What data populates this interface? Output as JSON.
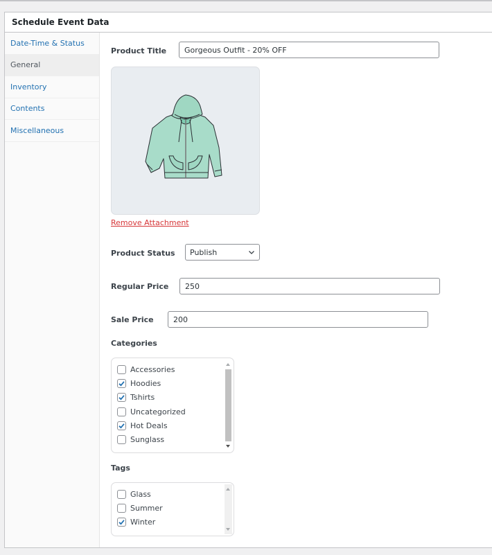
{
  "panel": {
    "title": "Schedule Event Data"
  },
  "sidebar": {
    "items": [
      {
        "label": "Date-Time & Status",
        "active": false
      },
      {
        "label": "General",
        "active": true
      },
      {
        "label": "Inventory",
        "active": false
      },
      {
        "label": "Contents",
        "active": false
      },
      {
        "label": "Miscellaneous",
        "active": false
      }
    ]
  },
  "form": {
    "product_title": {
      "label": "Product Title",
      "value": "Gorgeous Outfit - 20% OFF"
    },
    "image": {
      "alt": "hoodie-image",
      "remove_label": "Remove Attachment"
    },
    "product_status": {
      "label": "Product Status",
      "value": "Publish"
    },
    "regular_price": {
      "label": "Regular Price",
      "value": "250"
    },
    "sale_price": {
      "label": "Sale Price",
      "value": "200"
    },
    "categories": {
      "label": "Categories",
      "items": [
        {
          "label": "Accessories",
          "checked": false
        },
        {
          "label": "Hoodies",
          "checked": true
        },
        {
          "label": "Tshirts",
          "checked": true
        },
        {
          "label": "Uncategorized",
          "checked": false
        },
        {
          "label": "Hot Deals",
          "checked": true
        },
        {
          "label": "Sunglass",
          "checked": false
        }
      ]
    },
    "tags": {
      "label": "Tags",
      "items": [
        {
          "label": "Glass",
          "checked": false
        },
        {
          "label": "Summer",
          "checked": false
        },
        {
          "label": "Winter",
          "checked": true
        }
      ]
    }
  },
  "colors": {
    "link": "#2271b1",
    "danger": "#d63638",
    "checkmark": "#2271b1",
    "hoodie": "#a8dcc9"
  }
}
